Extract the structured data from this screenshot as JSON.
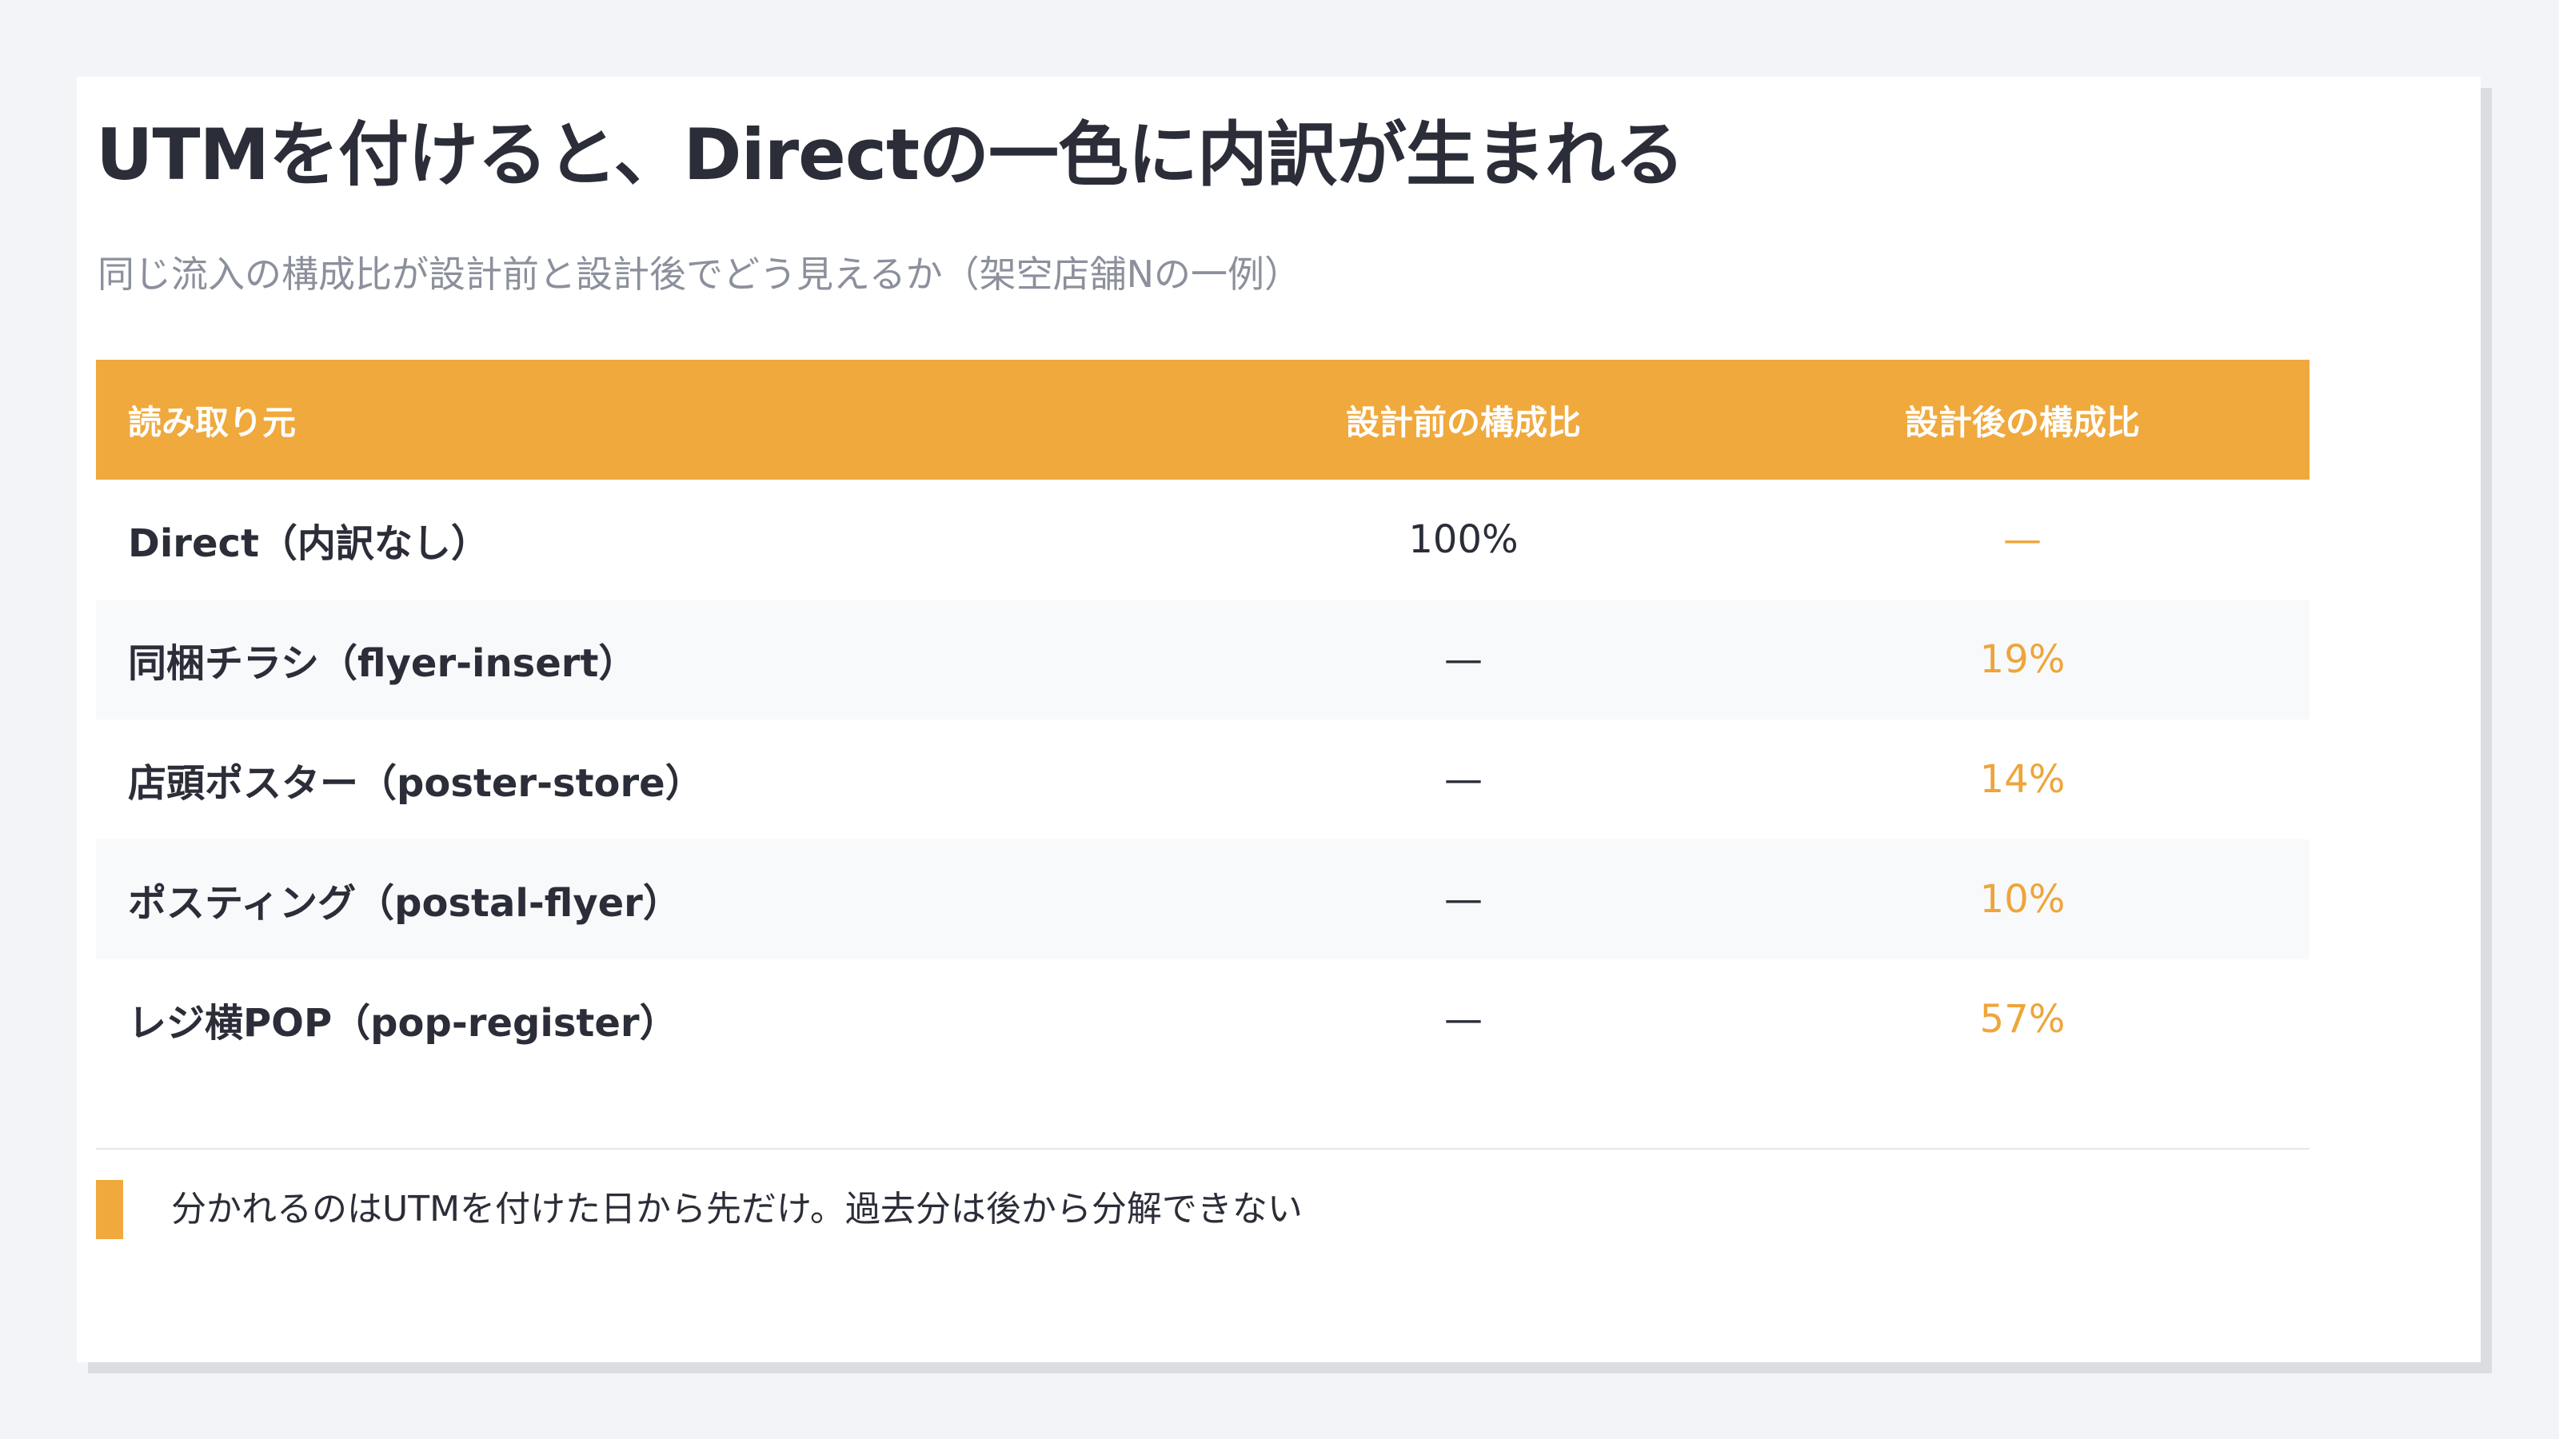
{
  "header": {
    "title": "UTMを付けると、Directの一色に内訳が生まれる",
    "subtitle": "同じ流入の構成比が設計前と設計後でどう見えるか（架空店舗Nの一例）"
  },
  "table": {
    "columns": [
      "読み取り元",
      "設計前の構成比",
      "設計後の構成比"
    ],
    "rows": [
      {
        "source": "Direct（内訳なし）",
        "before": "100%",
        "after": "—"
      },
      {
        "source": "同梱チラシ（flyer-insert）",
        "before": "—",
        "after": "19%"
      },
      {
        "source": "店頭ポスター（poster-store）",
        "before": "—",
        "after": "14%"
      },
      {
        "source": "ポスティング（postal-flyer）",
        "before": "—",
        "after": "10%"
      },
      {
        "source": "レジ横POP（pop-register）",
        "before": "—",
        "after": "57%"
      }
    ]
  },
  "note": {
    "text": "分かれるのはUTMを付けた日から先だけ。過去分は後から分解できない"
  },
  "colors": {
    "accent": "#f0a93d",
    "accent_text": "#eea53a",
    "title_text": "#2b2e38",
    "subtitle_text": "#8b909c",
    "background": "#f3f4f8"
  }
}
